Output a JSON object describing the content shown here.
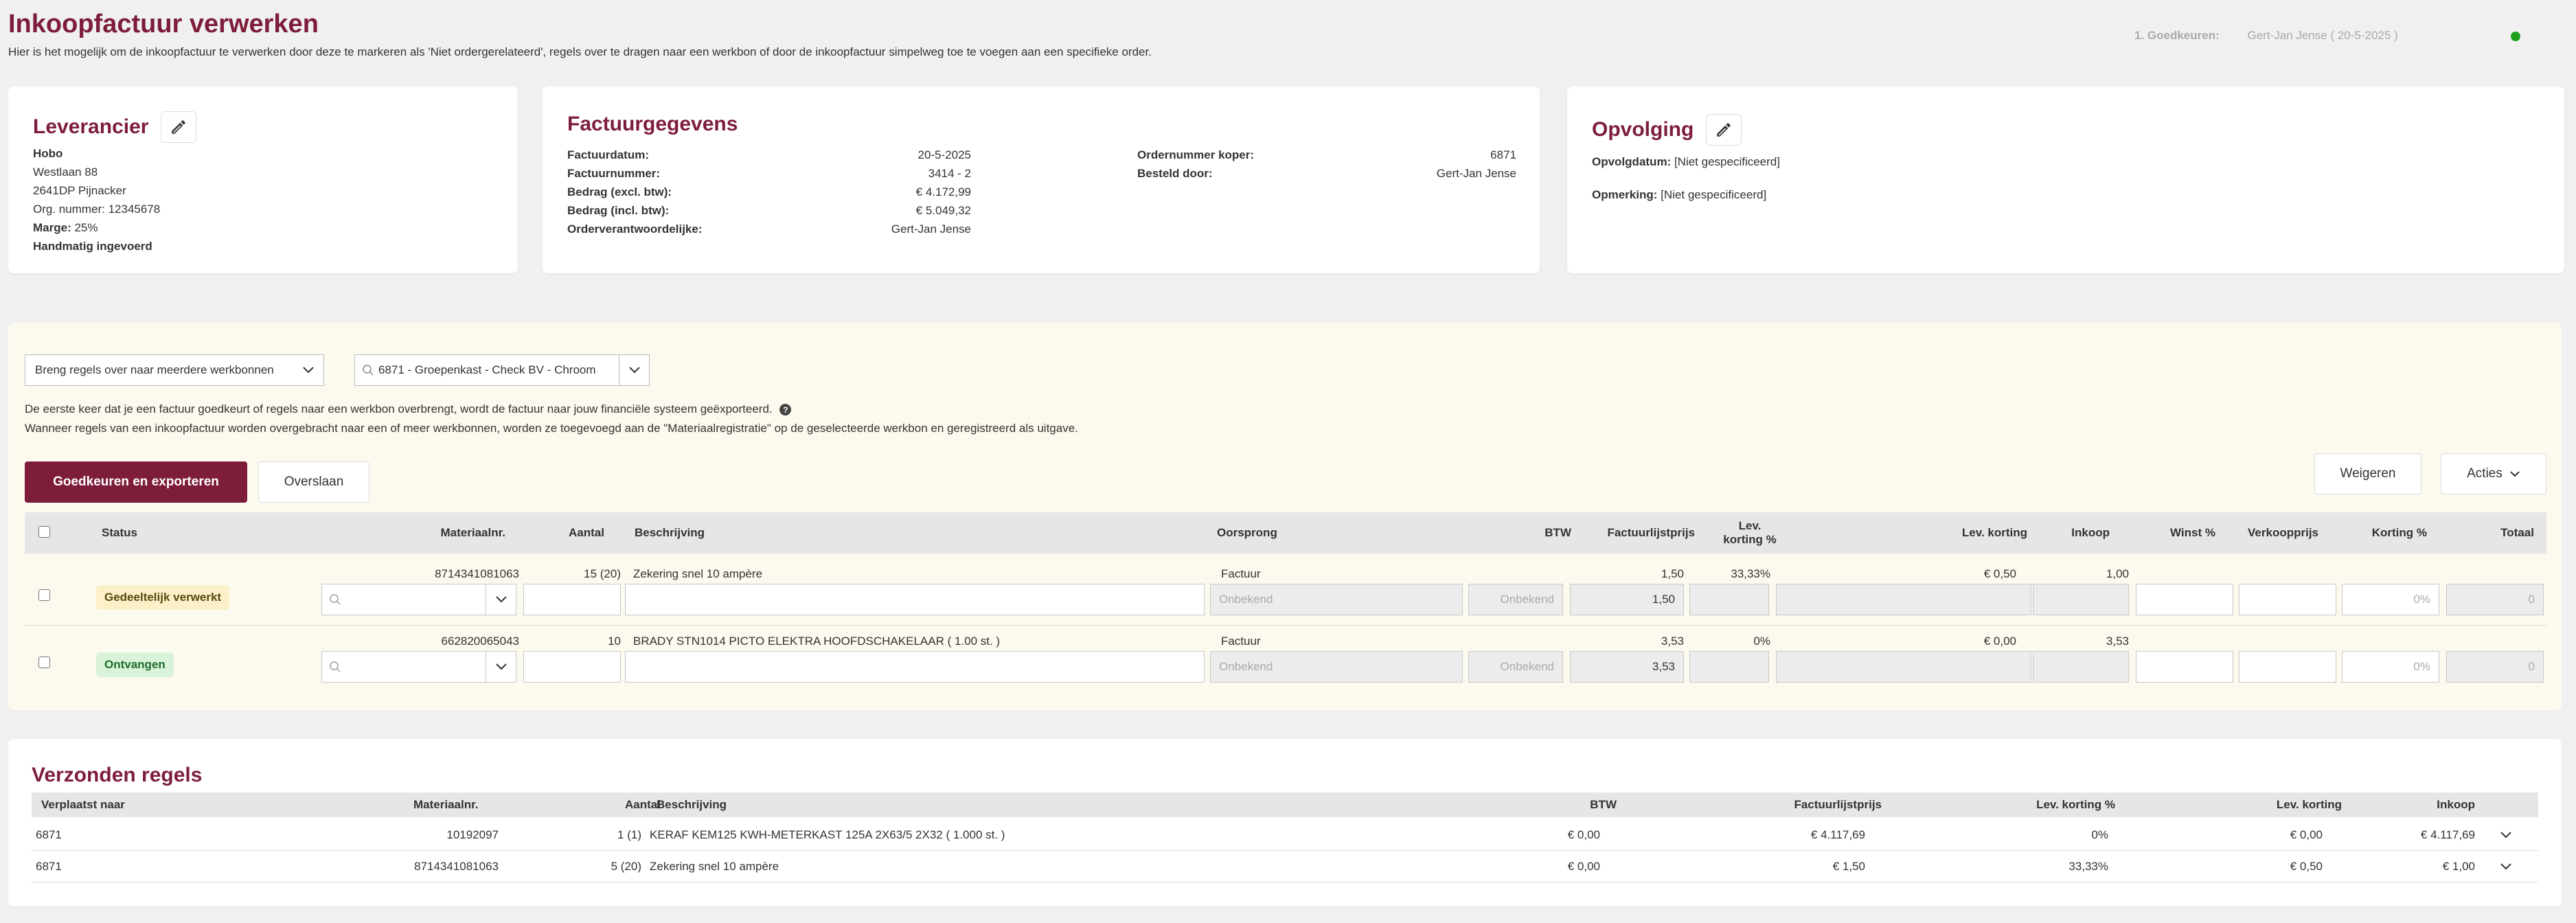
{
  "header": {
    "title": "Inkoopfactuur verwerken",
    "subtitle": "Hier is het mogelijk om de inkoopfactuur te verwerken door deze te markeren als 'Niet ordergerelateerd', regels over te dragen naar een werkbon of door de inkoopfactuur simpelweg toe te voegen aan een specifieke order.",
    "approval_label": "1. Goedkeuren:",
    "approval_value": "Gert-Jan Jense ( 20-5-2025 )",
    "status_color": "#1fa01f"
  },
  "supplier": {
    "title": "Leverancier",
    "name": "Hobo",
    "street": "Westlaan 88",
    "city": "2641DP Pijnacker",
    "org": "Org. nummer: 12345678",
    "margin_label": "Marge:",
    "margin_value": "25%",
    "manual": "Handmatig ingevoerd"
  },
  "invoice": {
    "title": "Factuurgegevens",
    "left": [
      {
        "label": "Factuurdatum:",
        "value": "20-5-2025"
      },
      {
        "label": "Factuurnummer:",
        "value": "3414 - 2"
      },
      {
        "label": "Bedrag (excl. btw):",
        "value": "€ 4.172,99"
      },
      {
        "label": "Bedrag (incl. btw):",
        "value": "€ 5.049,32"
      },
      {
        "label": "Orderverantwoordelijke:",
        "value": "Gert-Jan Jense"
      }
    ],
    "right": [
      {
        "label": "Ordernummer koper:",
        "value": "6871"
      },
      {
        "label": "Besteld door:",
        "value": "Gert-Jan Jense"
      }
    ]
  },
  "followup": {
    "title": "Opvolging",
    "date_label": "Opvolgdatum:",
    "date_value": "[Niet gespecificeerd]",
    "remark_label": "Opmerking:",
    "remark_value": "[Niet gespecificeerd]"
  },
  "transfer": {
    "mode_select": "Breng regels over naar meerdere werkbonnen",
    "workorder_select": "6871 - Groepenkast - Check BV - Chroom",
    "info_line1": "De eerste keer dat je een factuur goedkeurt of regels naar een werkbon overbrengt, wordt de factuur naar jouw financiële systeem geëxporteerd.",
    "help_glyph": "?",
    "info_line2": "Wanneer regels van een inkoopfactuur worden overgebracht naar een of meer werkbonnen, worden ze toegevoegd aan de \"Materiaalregistratie\" op de geselecteerde werkbon en geregistreerd als uitgave."
  },
  "buttons": {
    "approve": "Goedkeuren en exporteren",
    "skip": "Overslaan",
    "reject": "Weigeren",
    "actions": "Acties"
  },
  "table": {
    "headers": {
      "status": "Status",
      "material": "Materiaalnr.",
      "qty": "Aantal",
      "desc": "Beschrijving",
      "origin": "Oorsprong",
      "vat": "BTW",
      "listprice": "Factuurlijstprijs",
      "disc_pct_1": "Lev.",
      "disc_pct_2": "korting %",
      "disc": "Lev. korting",
      "purchase": "Inkoop",
      "profit": "Winst %",
      "sale": "Verkoopprijs",
      "discount": "Korting %",
      "total": "Totaal"
    },
    "rows": [
      {
        "status": "Gedeeltelijk verwerkt",
        "material": "8714341081063",
        "qty": "15 (20)",
        "desc": "Zekering snel 10 ampère",
        "origin": "Factuur",
        "listprice": "1,50",
        "disc_pct": "33,33%",
        "disc": "€ 0,50",
        "purchase": "1,00",
        "origin_input": "Onbekend",
        "vat_input": "Onbekend",
        "listprice_input": "1,50",
        "discount_input": "0%",
        "total_input": "0"
      },
      {
        "status": "Ontvangen",
        "material": "662820065043",
        "qty": "10",
        "desc": "BRADY STN1014 PICTO ELEKTRA HOOFDSCHAKELAAR ( 1.00 st. )",
        "origin": "Factuur",
        "listprice": "3,53",
        "disc_pct": "0%",
        "disc": "€ 0,00",
        "purchase": "3,53",
        "origin_input": "Onbekend",
        "vat_input": "Onbekend",
        "listprice_input": "3,53",
        "discount_input": "0%",
        "total_input": "0"
      }
    ]
  },
  "sent": {
    "title": "Verzonden regels",
    "headers": {
      "moved": "Verplaatst naar",
      "material": "Materiaalnr.",
      "qty": "Aantal",
      "desc": "Beschrijving",
      "vat": "BTW",
      "listprice": "Factuurlijstprijs",
      "disc_pct": "Lev. korting %",
      "disc": "Lev. korting",
      "purchase": "Inkoop"
    },
    "rows": [
      {
        "moved": "6871",
        "material": "10192097",
        "qty": "1 (1)",
        "desc": "KERAF KEM125 KWH-METERKAST 125A 2X63/5 2X32 ( 1.000 st. )",
        "vat": "€ 0,00",
        "listprice": "€ 4.117,69",
        "disc_pct": "0%",
        "disc": "€ 0,00",
        "purchase": "€ 4.117,69"
      },
      {
        "moved": "6871",
        "material": "8714341081063",
        "qty": "5 (20)",
        "desc": "Zekering snel 10 ampère",
        "vat": "€ 0,00",
        "listprice": "€ 1,50",
        "disc_pct": "33,33%",
        "disc": "€ 0,50",
        "purchase": "€ 1,00"
      }
    ]
  }
}
